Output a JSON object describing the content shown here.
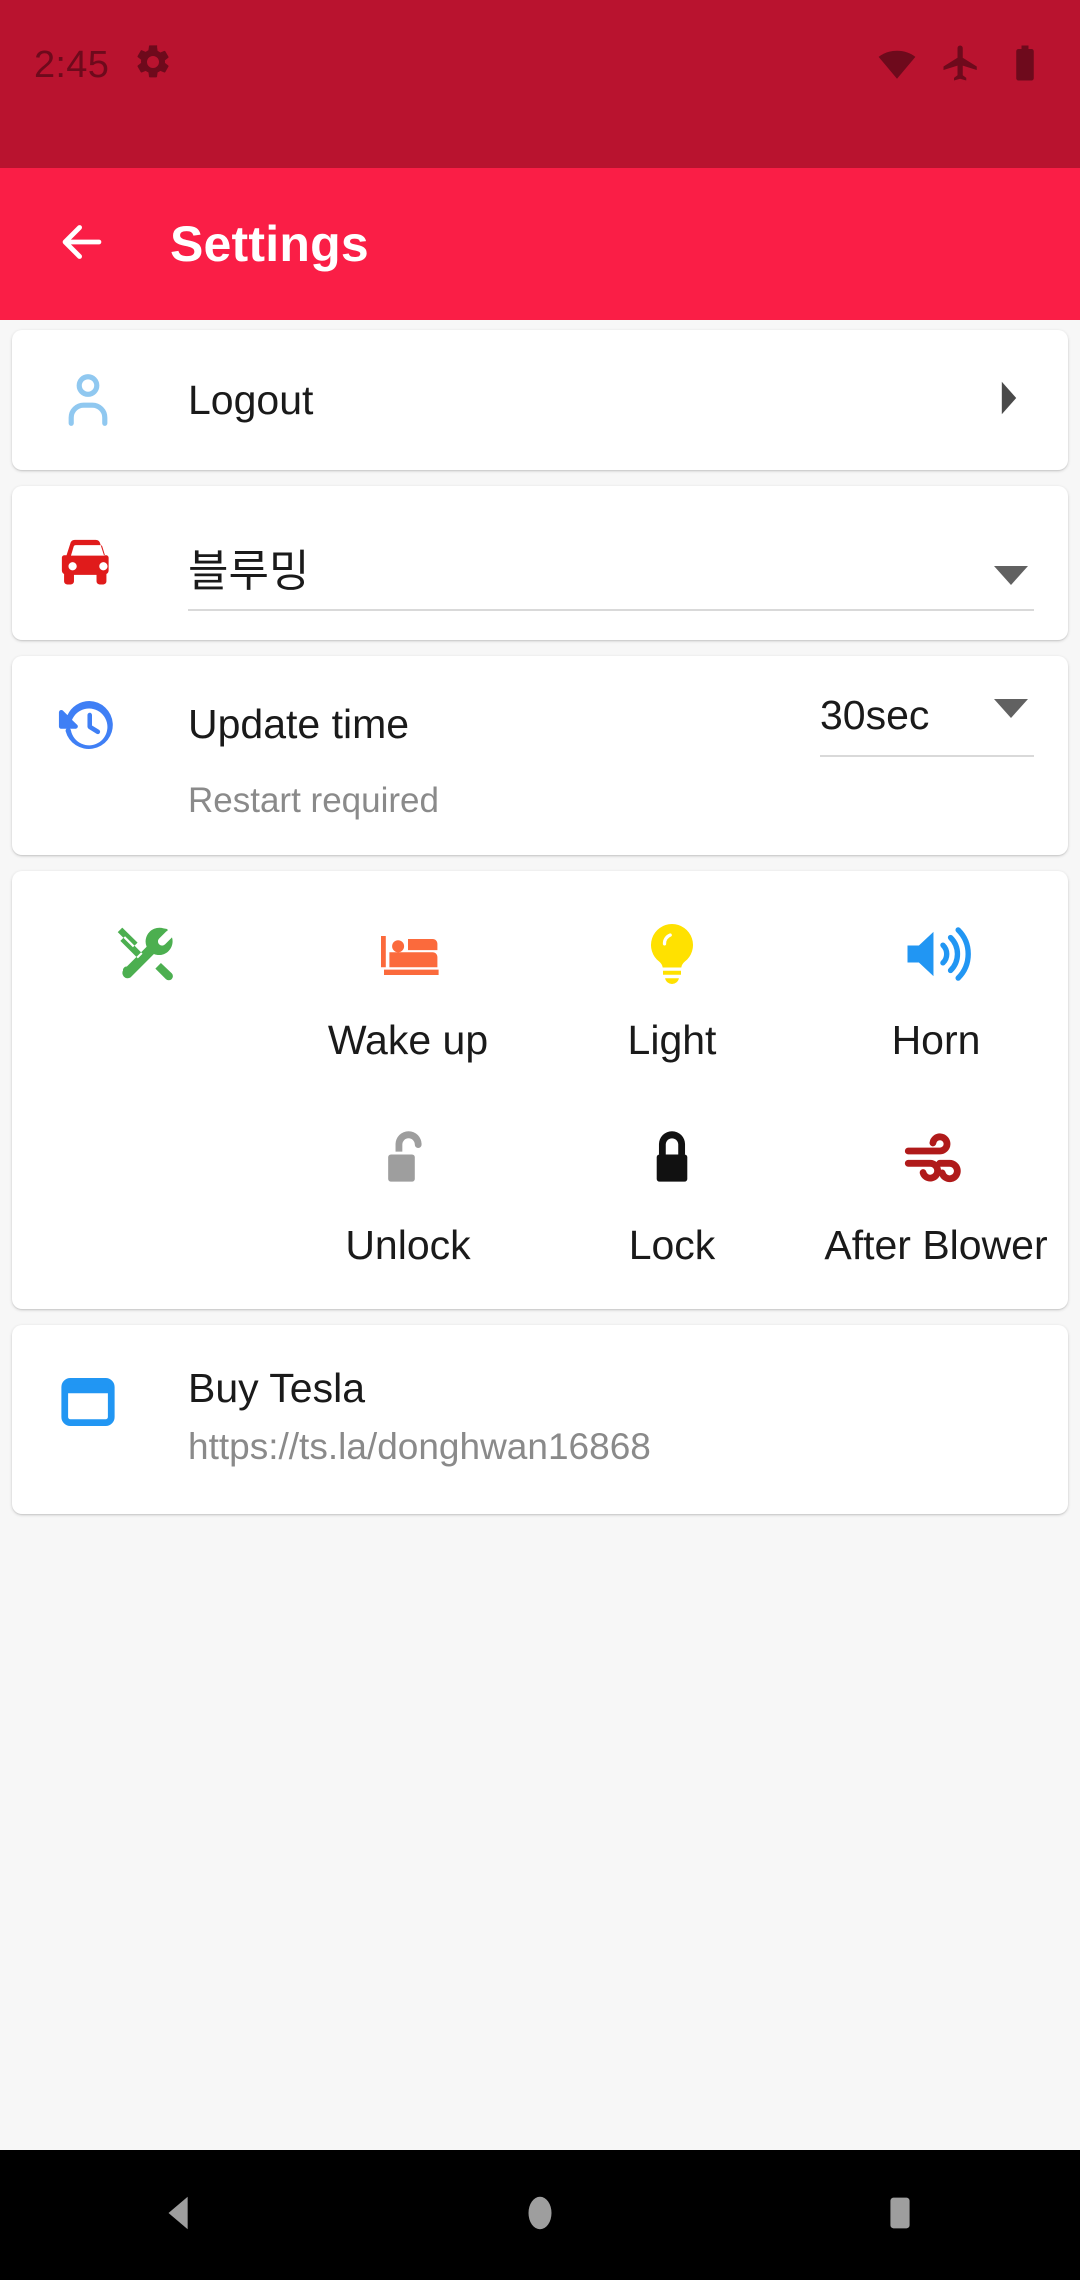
{
  "status_bar": {
    "clock": "2:45",
    "background_color": "#B9132F",
    "icon_color": "#6E0A1C",
    "icons": [
      "gear-icon",
      "wifi-icon",
      "airplane-mode-icon",
      "battery-full-icon"
    ]
  },
  "app_bar": {
    "title": "Settings",
    "background_color": "#FA1E46",
    "back_icon": "arrow-left-icon"
  },
  "cards": {
    "logout": {
      "label": "Logout",
      "icon": "person-icon",
      "icon_color": "#90C8F0",
      "chevron": "chevron-right-icon"
    },
    "vehicle": {
      "selected": "블루밍",
      "icon": "car-icon",
      "icon_color": "#E01B1B",
      "dropdown_icon": "triangle-down-icon"
    },
    "update_time": {
      "label": "Update time",
      "value": "30sec",
      "note": "Restart required",
      "icon": "history-restore-icon",
      "icon_color": "#3F7FF5",
      "dropdown_icon": "triangle-down-icon"
    },
    "actions": {
      "rows": [
        [
          {
            "label": "",
            "icon": "tools-service-icon",
            "icon_color": "#4CAF50"
          },
          {
            "label": "Wake up",
            "icon": "bed-icon",
            "icon_color": "#FB6A3C"
          },
          {
            "label": "Light",
            "icon": "lightbulb-icon",
            "icon_color": "#FFE100"
          },
          {
            "label": "Horn",
            "icon": "volume-speaker-icon",
            "icon_color": "#2196F3"
          }
        ],
        [
          {
            "label": "",
            "icon": "",
            "icon_color": ""
          },
          {
            "label": "Unlock",
            "icon": "lock-open-icon",
            "icon_color": "#9E9E9E"
          },
          {
            "label": "Lock",
            "icon": "lock-closed-icon",
            "icon_color": "#111111"
          },
          {
            "label": "After Blower",
            "icon": "wind-air-icon",
            "icon_color": "#B01A1A"
          }
        ]
      ]
    },
    "buy_tesla": {
      "title": "Buy Tesla",
      "url": "https://ts.la/donghwan16868",
      "icon": "browser-window-icon",
      "icon_color": "#2196F3"
    }
  },
  "nav_bar": {
    "background_color": "#000000",
    "icon_color": "#9E9E9E",
    "buttons": [
      {
        "name": "back",
        "icon": "nav-back-triangle-icon"
      },
      {
        "name": "home",
        "icon": "nav-home-circle-icon"
      },
      {
        "name": "recents",
        "icon": "nav-recents-square-icon"
      }
    ]
  }
}
